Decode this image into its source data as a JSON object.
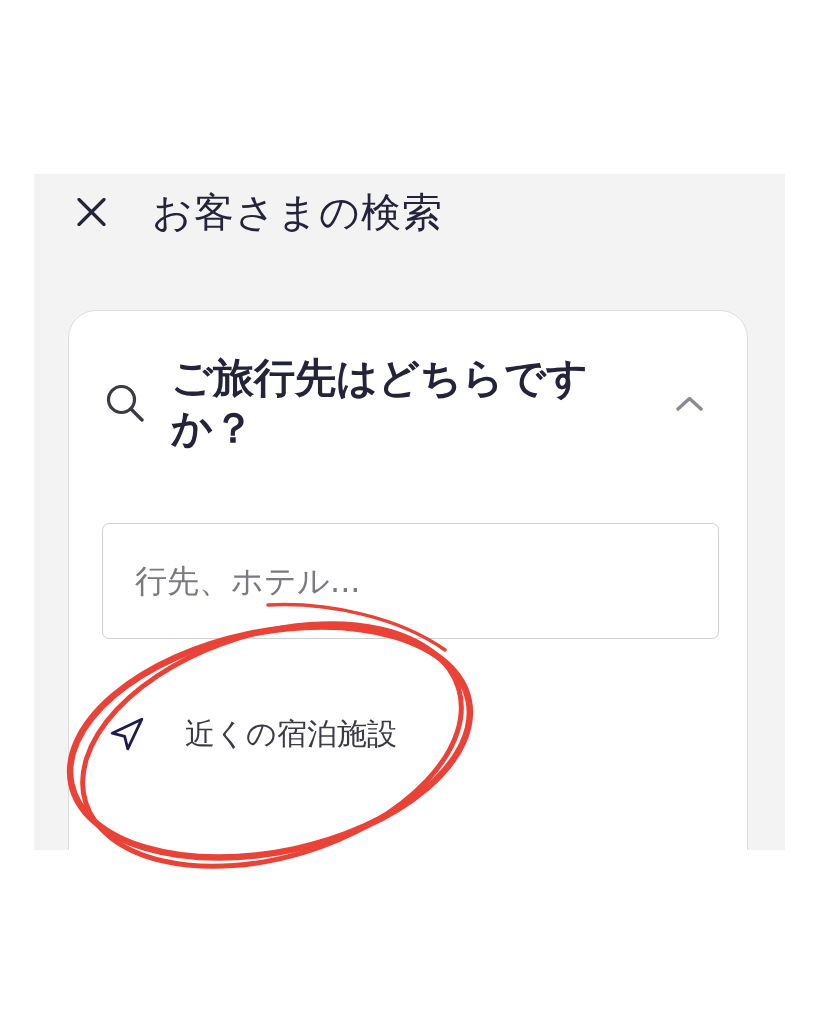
{
  "header": {
    "title": "お客さまの検索"
  },
  "destination_card": {
    "title": "ご旅行先はどちらですか？",
    "expanded": true,
    "search_field": {
      "placeholder": "行先、ホテル..."
    },
    "options": [
      {
        "kind": "nearby",
        "label": "近くの宿泊施設"
      }
    ]
  }
}
